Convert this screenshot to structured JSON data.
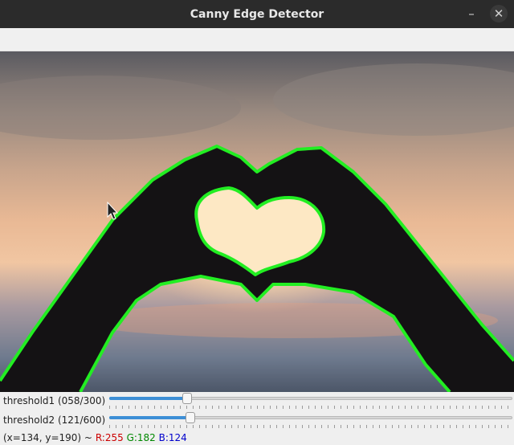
{
  "window": {
    "title": "Canny Edge Detector",
    "minimize_icon": "minimize-icon",
    "close_icon": "close-icon"
  },
  "trackbars": [
    {
      "label": "threshold1 (058/300)",
      "value": 58,
      "max": 300
    },
    {
      "label": "threshold2 (121/600)",
      "value": 121,
      "max": 600
    }
  ],
  "status": {
    "coords": "(x=134, y=190) ~",
    "r": "R:255",
    "g": "G:182",
    "b": "B:124"
  },
  "colors": {
    "edge": "#22ee22",
    "slider_fill": "#3d8fd6"
  },
  "cursor_icon": "arrow-cursor-icon"
}
